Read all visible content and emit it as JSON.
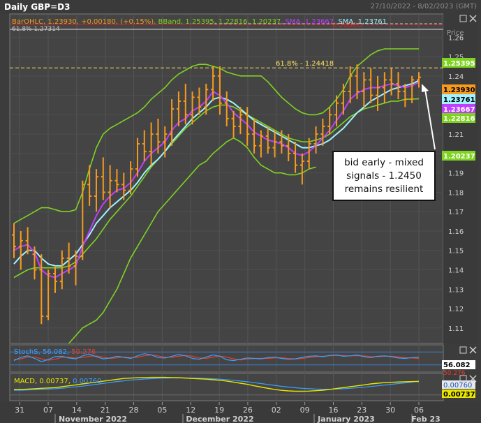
{
  "window": {
    "title": "Daily GBP=D3",
    "date_range": "27/10/2022 - 8/02/2023 (GMT)",
    "price_label": "Price"
  },
  "legend": {
    "bar_ohlc": "BarOHLC, 1.23930, +0.00180, (+0.15%)",
    "bband": "BBand, 1.25395, 1.22816, 1.20237",
    "sma_purple": "SMA, 1.23667",
    "sma_cyan": "SMA, 1.23761",
    "corner_fragment": "61.8%  1.27314"
  },
  "annotation": "bid early - mixed\nsignals - 1.2450\nremains resilient",
  "colors": {
    "ohlc": "#f79a1d",
    "bband": "#7ed321",
    "sma_purple": "#c13cff",
    "sma_cyan": "#9ff2ff",
    "fib_line": "#ffe066",
    "red_line": "#d62020",
    "stoch_k": "#3aa0ff",
    "stoch_d": "#e8402a",
    "macd": "#e8e600",
    "macd_signal": "#3aa0ff"
  },
  "price_badges": [
    {
      "value": "1.25395",
      "bg": "#7ed321",
      "fg": "#ffffff"
    },
    {
      "value": "1.23930",
      "bg": "#f79a1d",
      "fg": "#000000"
    },
    {
      "value": "1.23761",
      "bg": "#9ff2ff",
      "fg": "#000000"
    },
    {
      "value": "1.23667",
      "bg": "#c13cff",
      "fg": "#ffffff"
    },
    {
      "value": "1.22816",
      "bg": "#7ed321",
      "fg": "#ffffff"
    },
    {
      "value": "1.20237",
      "bg": "#7ed321",
      "fg": "#ffffff"
    }
  ],
  "stoch": {
    "legend_name": "StochS",
    "k": "56.082",
    "d": "50.276",
    "badge": "56.082",
    "badge_d": "50.276"
  },
  "macd": {
    "legend_name": "MACD",
    "value": "0.00737",
    "signal": "0.00760",
    "badge_signal": "0.00760",
    "badge_macd": "0.00737"
  },
  "x_axis": {
    "day_ticks": [
      "31",
      "07",
      "14",
      "21",
      "28",
      "05",
      "12",
      "19",
      "26",
      "02",
      "09",
      "16",
      "23",
      "30",
      "06"
    ],
    "months": [
      "November 2022",
      "December 2022",
      "January 2023",
      "Feb 23"
    ]
  },
  "chart_data": {
    "type": "line",
    "title": "Daily GBP=D3",
    "y_axis_label": "Price",
    "ylim": [
      1.102,
      1.272
    ],
    "y_ticks": [
      1.11,
      1.12,
      1.13,
      1.14,
      1.15,
      1.16,
      1.17,
      1.18,
      1.19,
      1.2,
      1.21,
      1.22,
      1.23,
      1.24,
      1.25,
      1.26
    ],
    "horizontal_lines": [
      {
        "label": "61.8% - 1.24418",
        "value": 1.24418,
        "style": "dashed"
      },
      {
        "label": "1.26665",
        "value": 1.26665,
        "style": "solid"
      }
    ],
    "ohlc": [
      [
        1.158,
        1.164,
        1.146,
        1.152
      ],
      [
        1.152,
        1.16,
        1.14,
        1.155
      ],
      [
        1.155,
        1.162,
        1.148,
        1.15
      ],
      [
        1.148,
        1.152,
        1.135,
        1.14
      ],
      [
        1.14,
        1.148,
        1.112,
        1.116
      ],
      [
        1.116,
        1.14,
        1.114,
        1.138
      ],
      [
        1.138,
        1.142,
        1.128,
        1.134
      ],
      [
        1.134,
        1.15,
        1.13,
        1.146
      ],
      [
        1.146,
        1.154,
        1.138,
        1.142
      ],
      [
        1.142,
        1.15,
        1.132,
        1.147
      ],
      [
        1.147,
        1.186,
        1.145,
        1.184
      ],
      [
        1.184,
        1.194,
        1.173,
        1.178
      ],
      [
        1.178,
        1.192,
        1.17,
        1.188
      ],
      [
        1.188,
        1.198,
        1.176,
        1.18
      ],
      [
        1.18,
        1.194,
        1.172,
        1.186
      ],
      [
        1.186,
        1.192,
        1.18,
        1.184
      ],
      [
        1.184,
        1.19,
        1.176,
        1.181
      ],
      [
        1.181,
        1.196,
        1.179,
        1.192
      ],
      [
        1.192,
        1.208,
        1.188,
        1.205
      ],
      [
        1.205,
        1.212,
        1.196,
        1.201
      ],
      [
        1.201,
        1.216,
        1.194,
        1.21
      ],
      [
        1.21,
        1.218,
        1.2,
        1.206
      ],
      [
        1.206,
        1.214,
        1.198,
        1.21
      ],
      [
        1.21,
        1.228,
        1.204,
        1.223
      ],
      [
        1.223,
        1.232,
        1.214,
        1.227
      ],
      [
        1.227,
        1.236,
        1.215,
        1.22
      ],
      [
        1.22,
        1.232,
        1.215,
        1.229
      ],
      [
        1.229,
        1.234,
        1.22,
        1.224
      ],
      [
        1.224,
        1.236,
        1.22,
        1.233
      ],
      [
        1.233,
        1.245,
        1.227,
        1.24
      ],
      [
        1.24,
        1.245,
        1.22,
        1.226
      ],
      [
        1.226,
        1.232,
        1.214,
        1.218
      ],
      [
        1.218,
        1.222,
        1.208,
        1.214
      ],
      [
        1.214,
        1.224,
        1.21,
        1.22
      ],
      [
        1.22,
        1.224,
        1.204,
        1.21
      ],
      [
        1.21,
        1.218,
        1.2,
        1.204
      ],
      [
        1.204,
        1.212,
        1.198,
        1.209
      ],
      [
        1.209,
        1.214,
        1.2,
        1.203
      ],
      [
        1.203,
        1.212,
        1.198,
        1.206
      ],
      [
        1.206,
        1.212,
        1.2,
        1.204
      ],
      [
        1.204,
        1.21,
        1.196,
        1.2
      ],
      [
        1.2,
        1.206,
        1.19,
        1.194
      ],
      [
        1.194,
        1.2,
        1.184,
        1.196
      ],
      [
        1.196,
        1.208,
        1.192,
        1.205
      ],
      [
        1.205,
        1.214,
        1.2,
        1.21
      ],
      [
        1.21,
        1.218,
        1.204,
        1.214
      ],
      [
        1.214,
        1.224,
        1.21,
        1.22
      ],
      [
        1.22,
        1.23,
        1.214,
        1.226
      ],
      [
        1.226,
        1.236,
        1.22,
        1.232
      ],
      [
        1.232,
        1.245,
        1.226,
        1.24
      ],
      [
        1.24,
        1.246,
        1.228,
        1.232
      ],
      [
        1.232,
        1.242,
        1.224,
        1.238
      ],
      [
        1.238,
        1.244,
        1.226,
        1.23
      ],
      [
        1.23,
        1.24,
        1.222,
        1.234
      ],
      [
        1.234,
        1.242,
        1.226,
        1.238
      ],
      [
        1.238,
        1.244,
        1.23,
        1.236
      ],
      [
        1.236,
        1.242,
        1.228,
        1.232
      ],
      [
        1.232,
        1.236,
        1.224,
        1.228
      ],
      [
        1.228,
        1.24,
        1.226,
        1.238
      ],
      [
        1.238,
        1.242,
        1.234,
        1.2393
      ]
    ],
    "series": [
      {
        "name": "SMA 1.23761",
        "values": [
          1.143,
          1.147,
          1.15,
          1.15,
          1.146,
          1.143,
          1.142,
          1.142,
          1.145,
          1.148,
          1.153,
          1.158,
          1.164,
          1.168,
          1.172,
          1.175,
          1.178,
          1.181,
          1.185,
          1.19,
          1.194,
          1.197,
          1.201,
          1.206,
          1.21,
          1.214,
          1.218,
          1.221,
          1.224,
          1.228,
          1.229,
          1.228,
          1.226,
          1.223,
          1.22,
          1.217,
          1.215,
          1.213,
          1.211,
          1.209,
          1.207,
          1.205,
          1.203,
          1.203,
          1.204,
          1.205,
          1.207,
          1.21,
          1.213,
          1.217,
          1.221,
          1.224,
          1.227,
          1.229,
          1.231,
          1.233,
          1.234,
          1.235,
          1.236,
          1.2376
        ]
      },
      {
        "name": "SMA 1.23667",
        "values": [
          1.15,
          1.152,
          1.153,
          1.149,
          1.14,
          1.137,
          1.136,
          1.138,
          1.14,
          1.142,
          1.152,
          1.16,
          1.168,
          1.174,
          1.178,
          1.181,
          1.182,
          1.185,
          1.19,
          1.196,
          1.2,
          1.203,
          1.206,
          1.212,
          1.216,
          1.218,
          1.222,
          1.224,
          1.227,
          1.232,
          1.23,
          1.226,
          1.221,
          1.218,
          1.215,
          1.211,
          1.209,
          1.207,
          1.206,
          1.205,
          1.203,
          1.2,
          1.199,
          1.201,
          1.204,
          1.208,
          1.212,
          1.217,
          1.222,
          1.228,
          1.231,
          1.233,
          1.234,
          1.234,
          1.235,
          1.236,
          1.235,
          1.234,
          1.235,
          1.2367
        ]
      },
      {
        "name": "BBand upper",
        "values": [
          1.164,
          1.166,
          1.168,
          1.17,
          1.172,
          1.172,
          1.171,
          1.17,
          1.17,
          1.171,
          1.18,
          1.192,
          1.203,
          1.21,
          1.213,
          1.215,
          1.217,
          1.219,
          1.221,
          1.224,
          1.228,
          1.231,
          1.234,
          1.238,
          1.241,
          1.243,
          1.245,
          1.246,
          1.246,
          1.245,
          1.244,
          1.242,
          1.241,
          1.24,
          1.24,
          1.24,
          1.24,
          1.237,
          1.233,
          1.229,
          1.226,
          1.223,
          1.221,
          1.22,
          1.22,
          1.221,
          1.224,
          1.228,
          1.233,
          1.24,
          1.245,
          1.248,
          1.251,
          1.253,
          1.254,
          1.254,
          1.254,
          1.254,
          1.254,
          1.254
        ]
      },
      {
        "name": "BBand middle",
        "values": [
          1.136,
          1.138,
          1.14,
          1.141,
          1.141,
          1.141,
          1.141,
          1.141,
          1.142,
          1.144,
          1.148,
          1.152,
          1.156,
          1.161,
          1.166,
          1.17,
          1.174,
          1.178,
          1.183,
          1.188,
          1.193,
          1.197,
          1.201,
          1.205,
          1.209,
          1.213,
          1.216,
          1.219,
          1.222,
          1.224,
          1.225,
          1.225,
          1.224,
          1.222,
          1.22,
          1.218,
          1.216,
          1.214,
          1.212,
          1.21,
          1.208,
          1.207,
          1.206,
          1.206,
          1.207,
          1.208,
          1.21,
          1.213,
          1.216,
          1.219,
          1.221,
          1.223,
          1.224,
          1.225,
          1.226,
          1.227,
          1.227,
          1.228,
          1.2281,
          1.2282
        ]
      },
      {
        "name": "BBand lower",
        "values": [
          null,
          null,
          null,
          null,
          null,
          null,
          null,
          null,
          1.102,
          1.106,
          1.11,
          1.112,
          1.114,
          1.118,
          1.124,
          1.13,
          1.138,
          1.146,
          1.152,
          1.158,
          1.164,
          1.17,
          1.174,
          1.178,
          1.182,
          1.186,
          1.19,
          1.194,
          1.196,
          1.2,
          1.203,
          1.206,
          1.208,
          1.206,
          1.203,
          1.198,
          1.194,
          1.192,
          1.19,
          1.19,
          1.189,
          1.189,
          1.19,
          1.192,
          1.193,
          null,
          null,
          null,
          null,
          null,
          null,
          null,
          null,
          null,
          null,
          null,
          null,
          null,
          null,
          null
        ]
      }
    ],
    "stochastic": {
      "k": [
        40,
        55,
        62,
        50,
        35,
        45,
        58,
        60,
        52,
        48,
        62,
        70,
        58,
        48,
        52,
        60,
        55,
        50,
        62,
        72,
        66,
        54,
        52,
        60,
        68,
        62,
        50,
        46,
        56,
        66,
        60,
        44,
        40,
        46,
        52,
        50,
        48,
        54,
        56,
        50,
        46,
        48,
        55,
        60,
        62,
        58,
        64,
        66,
        60,
        62,
        66,
        58,
        54,
        60,
        62,
        58,
        52,
        50,
        54,
        56
      ],
      "d": [
        45,
        48,
        56,
        56,
        48,
        42,
        46,
        55,
        56,
        52,
        54,
        60,
        62,
        56,
        50,
        53,
        57,
        54,
        55,
        62,
        66,
        62,
        56,
        55,
        60,
        64,
        60,
        52,
        50,
        56,
        61,
        56,
        48,
        43,
        46,
        50,
        50,
        50,
        53,
        53,
        50,
        48,
        50,
        54,
        58,
        60,
        62,
        64,
        63,
        62,
        63,
        62,
        58,
        58,
        60,
        60,
        57,
        54,
        52,
        50
      ]
    },
    "macd": {
      "macd": [
        0.003,
        0.003,
        0.0032,
        0.0034,
        0.0036,
        0.0038,
        0.004,
        0.0045,
        0.005,
        0.0055,
        0.006,
        0.0065,
        0.007,
        0.0075,
        0.008,
        0.0085,
        0.009,
        0.0092,
        0.0094,
        0.0095,
        0.0096,
        0.0096,
        0.0096,
        0.0095,
        0.0094,
        0.0092,
        0.009,
        0.0088,
        0.0086,
        0.0083,
        0.008,
        0.0076,
        0.007,
        0.0064,
        0.0058,
        0.005,
        0.0043,
        0.0036,
        0.003,
        0.0025,
        0.0022,
        0.002,
        0.002,
        0.0021,
        0.0023,
        0.0026,
        0.003,
        0.0035,
        0.004,
        0.0045,
        0.005,
        0.0055,
        0.006,
        0.0064,
        0.0067,
        0.0069,
        0.0071,
        0.0072,
        0.0073,
        0.00737
      ],
      "signal": [
        0.0025,
        0.0026,
        0.0027,
        0.0028,
        0.003,
        0.0032,
        0.0034,
        0.0037,
        0.004,
        0.0044,
        0.0048,
        0.0053,
        0.0058,
        0.0063,
        0.0068,
        0.0073,
        0.0077,
        0.0081,
        0.0084,
        0.0087,
        0.0089,
        0.0091,
        0.0092,
        0.0093,
        0.0093,
        0.0093,
        0.0092,
        0.0091,
        0.009,
        0.0088,
        0.0086,
        0.0083,
        0.008,
        0.0076,
        0.0072,
        0.0067,
        0.0062,
        0.0057,
        0.0052,
        0.0047,
        0.0043,
        0.0039,
        0.0036,
        0.0034,
        0.0032,
        0.0031,
        0.0031,
        0.0032,
        0.0034,
        0.0036,
        0.0039,
        0.0042,
        0.0046,
        0.005,
        0.0054,
        0.0058,
        0.0062,
        0.0066,
        0.007,
        0.0076
      ]
    }
  }
}
